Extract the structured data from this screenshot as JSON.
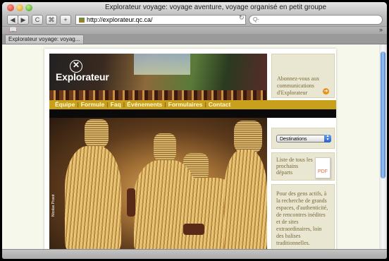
{
  "window": {
    "title": "Explorateur voyage: voyage aventure, voyage organisé en petit groupe",
    "tab_label": "Explorateur voyage: voyag..."
  },
  "toolbar": {
    "back_icon": "◀",
    "forward_icon": "▶",
    "reload_glyph": "C",
    "add_glyph": "+",
    "url": "http://explorateur.qc.ca/",
    "search_glyph": "Q-"
  },
  "site": {
    "logo": "Explorateur",
    "nav": [
      "Équipe",
      "Formule",
      "Faq",
      "Événements",
      "Formulaires",
      "Contact"
    ],
    "nav_separator": "|",
    "photo_credit": "Nicolas Pissot",
    "sidebar": {
      "newsletter": "Abonnez-vous aux communications d'Explorateur",
      "destinations_select": "Destinations",
      "departures": "Liste de tous les prochains départs",
      "pdf_label": "PDF",
      "tagline": "Pour des gens actifs, à la recherche de grands espaces, d'authenticité, de rencontres inédites et de sites extraordinaires, loin des balises traditionnelles."
    }
  },
  "colors": {
    "accent": "#c9a01c",
    "page_bg": "#f7f8ec",
    "sidebar_box": "#e9e6d2"
  }
}
